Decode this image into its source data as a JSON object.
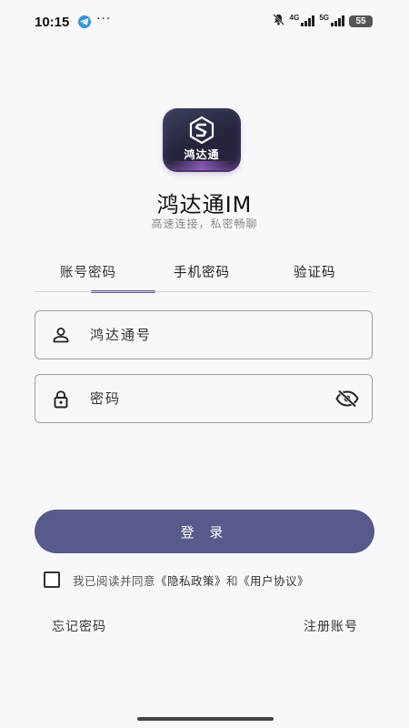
{
  "status_bar": {
    "time": "10:15",
    "dots": "···",
    "net_4g": "4G",
    "net_5g": "5G",
    "battery": "55",
    "icons": [
      "telegram-icon",
      "mute-icon",
      "signal-icon",
      "battery-icon"
    ]
  },
  "app": {
    "logo_text": "鸿达通",
    "title": "鸿达通IM",
    "subtitle": "高速连接，私密畅聊"
  },
  "tabs": [
    {
      "label": "账号密码",
      "active": true
    },
    {
      "label": "手机密码",
      "active": false
    },
    {
      "label": "验证码",
      "active": false
    }
  ],
  "form": {
    "account": {
      "value": "",
      "placeholder": "鸿达通号",
      "icon": "user-icon"
    },
    "password": {
      "value": "",
      "placeholder": "密码",
      "icon": "lock-icon",
      "toggle_icon": "eye-off-icon"
    },
    "login_label": "登 录"
  },
  "agreement": {
    "checked": false,
    "prefix": "我已阅读并同意",
    "privacy": "《隐私政策》",
    "and": "和",
    "terms": "《用户协议》"
  },
  "links": {
    "forgot": "忘记密码",
    "register": "注册账号"
  },
  "colors": {
    "accent": "#575a8a",
    "background": "#f8f8fa",
    "border": "#9c9ca4"
  }
}
